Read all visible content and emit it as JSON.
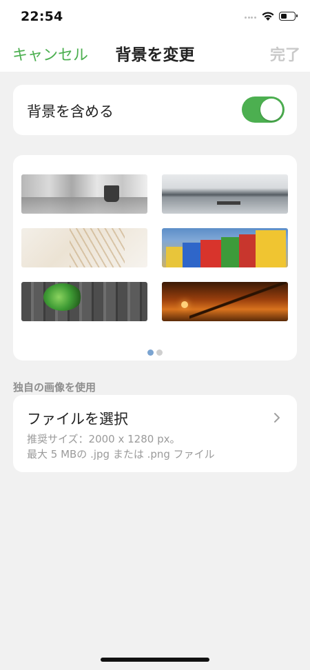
{
  "status_bar": {
    "time": "22:54"
  },
  "nav": {
    "cancel": "キャンセル",
    "title": "背景を変更",
    "done": "完了"
  },
  "include_background": {
    "label": "背景を含める",
    "enabled": true
  },
  "gallery": {
    "images": [
      "office-mug",
      "lake-pier",
      "wheat-grass",
      "colorful-huts",
      "ivy-wood",
      "sunset-bridge"
    ],
    "page_count": 2,
    "active_page": 1
  },
  "own_image": {
    "section_title": "独自の画像を使用",
    "choose_file": "ファイルを選択",
    "hint_line1": "推奨サイズ：2000 x 1280 px。",
    "hint_line2": "最大 5 MBの .jpg または .png ファイル"
  },
  "colors": {
    "accent": "#4caf50",
    "disabled": "#c9c9c9",
    "dot_active": "#7ba4d1"
  }
}
